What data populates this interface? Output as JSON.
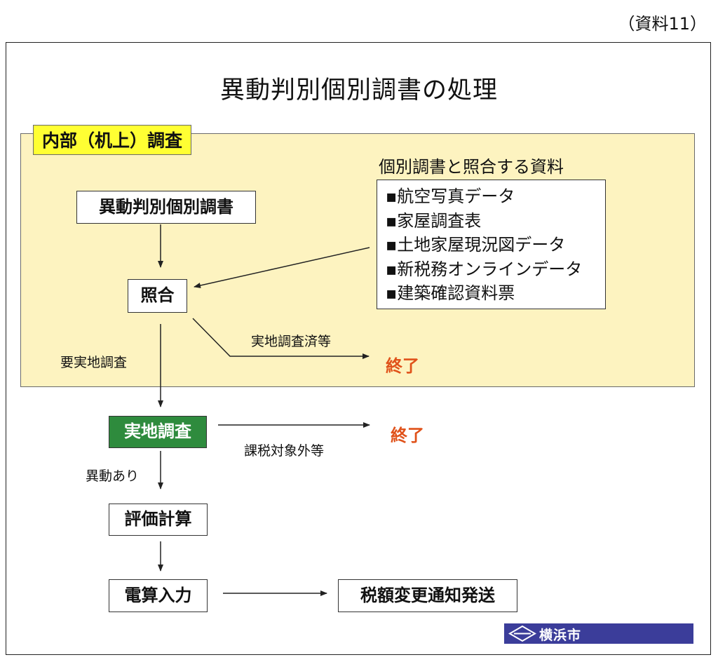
{
  "reference_label": "（資料11）",
  "title": "異動判別個別調書の処理",
  "zone_label": "内部（机上）調査",
  "boxes": {
    "ido_chosho": "異動判別個別調書",
    "shogo": "照合",
    "jichi_chosa": "実地調査",
    "hyoka_keisan": "評価計算",
    "densan_nyuryoku": "電算入力",
    "tsuchi_hasso": "税額変更通知発送"
  },
  "materials": {
    "heading": "個別調書と照合する資料",
    "items": [
      "▪航空写真データ",
      "▪家屋調査表",
      "▪土地家屋現況図データ",
      "▪新税務オンラインデータ",
      "▪建築確認資料票"
    ]
  },
  "edge_labels": {
    "jichi_chosazumi": "実地調査済等",
    "yo_jichi_chosa": "要実地調査",
    "kazei_taishogai": "課税対象外等",
    "ido_ari": "異動あり"
  },
  "end_label_1": "終了",
  "end_label_2": "終了",
  "logo": {
    "text": "横浜市",
    "background": "#3b3d9a"
  },
  "colors": {
    "zone_fill": "#fdf3c0",
    "zone_label_fill": "#ffff33",
    "field_survey_fill": "#2e8b3d",
    "end_color": "#e0521a"
  }
}
